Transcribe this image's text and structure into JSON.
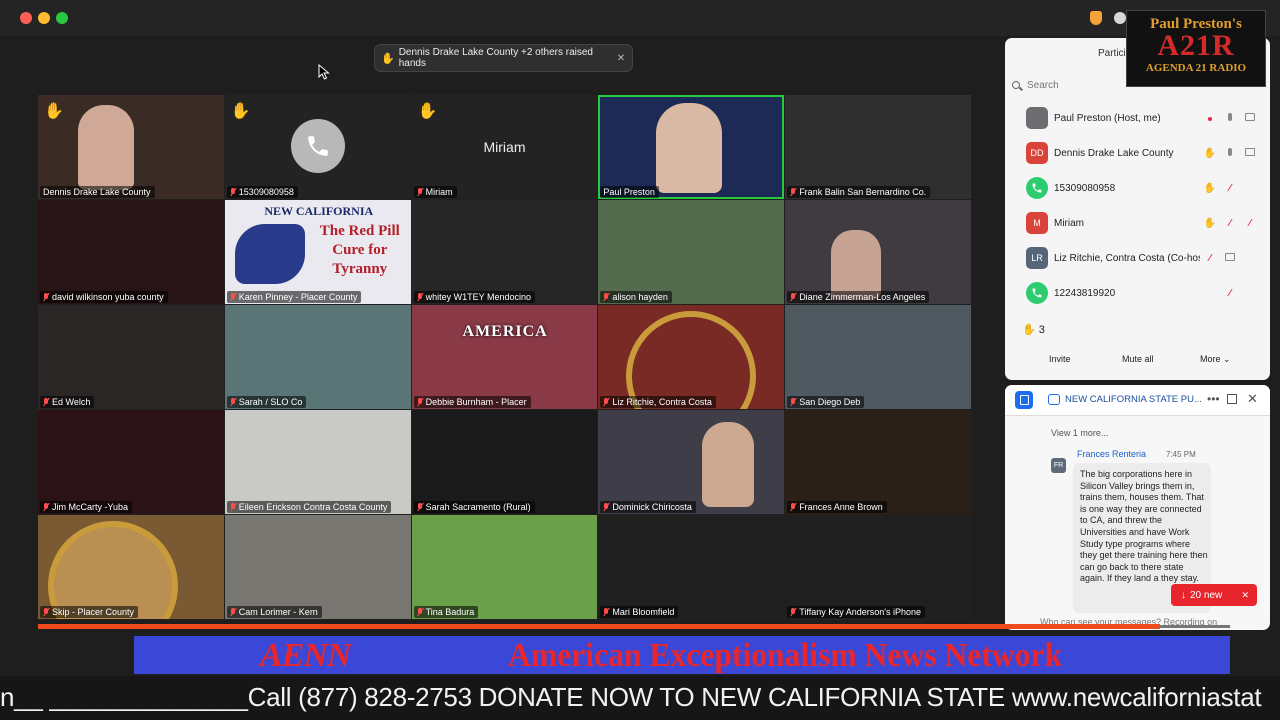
{
  "banner": {
    "text": "Dennis Drake  Lake County +2 others raised hands"
  },
  "hand_icon": "✋",
  "tiles": [
    {
      "name": "Dennis Drake  Lake County",
      "hand": true,
      "bg": "#3a2b24"
    },
    {
      "name": "15309080958",
      "hand": true,
      "phone": true,
      "bg": "#232323"
    },
    {
      "name": "Miriam",
      "hand": true,
      "big": "Miriam",
      "bg": "#232323"
    },
    {
      "name": "Paul Preston",
      "active": true,
      "bg": "#1d2a55"
    },
    {
      "name": "Frank Balin  San Bernardino Co.",
      "bg": "#2f2f2f"
    },
    {
      "name": "david wilkinson yuba county",
      "bg": "#261416"
    },
    {
      "name": "Karen Pinney - Placer County",
      "bg": "#e9e9ef"
    },
    {
      "name": "whitey  W1TEY Mendocino",
      "bg": "#262626"
    },
    {
      "name": "alison hayden",
      "bg": "#556b4e"
    },
    {
      "name": "Diane Zimmerman-Los Angeles",
      "bg": "#3f3b40"
    },
    {
      "name": "Ed Welch",
      "bg": "#2a2626"
    },
    {
      "name": "Sarah / SLO Co",
      "bg": "#5a7575"
    },
    {
      "name": "Debbie Burnham - Placer",
      "bg": "#8a3a46"
    },
    {
      "name": "Liz Ritchie, Contra Costa",
      "bg": "#7a2a25"
    },
    {
      "name": "San Diego Deb",
      "bg": "#4e5a60"
    },
    {
      "name": "Jim McCarty -Yuba",
      "bg": "#2a1217"
    },
    {
      "name": "Eileen Erickson Contra Costa County",
      "bg": "#c9c9c6"
    },
    {
      "name": "Sarah Sacramento (Rural)",
      "bg": "#1a1a1a"
    },
    {
      "name": "Dominick Chiricosta",
      "bg": "#3f3e48"
    },
    {
      "name": "Frances Anne Brown",
      "bg": "#2a2018"
    },
    {
      "name": "Skip - Placer County",
      "bg": "#7a5a32"
    },
    {
      "name": "Cam Lorimer - Kern",
      "bg": "#787670"
    },
    {
      "name": "Tina Badura",
      "bg": "#6aa04a"
    },
    {
      "name": "Mari Bloomfield",
      "bg": "#202020"
    },
    {
      "name": "Tiffany Kay Anderson's iPhone",
      "bg": "#202020"
    }
  ],
  "tile_text": {
    "karen_poster_l1": "NEW CALIFORNIA",
    "karen_poster_l2": "The Red Pill",
    "karen_poster_l3": "Cure for",
    "karen_poster_l4": "Tyranny",
    "debbie_poster": "AMERICA"
  },
  "participants": {
    "title": "Partici",
    "search_placeholder": "Search",
    "rows": [
      {
        "initials": "",
        "name": "Paul Preston (Host, me)",
        "avatar_color": "#6d6d72"
      },
      {
        "initials": "DD",
        "name": "Dennis Drake  Lake County",
        "avatar_color": "#d9443a"
      },
      {
        "initials": "",
        "name": "15309080958",
        "avatar_color": "#2ecc71"
      },
      {
        "initials": "M",
        "name": "Miriam",
        "avatar_color": "#d9443a"
      },
      {
        "initials": "LR",
        "name": "Liz Ritchie, Contra Costa (Co-host)",
        "avatar_color": "#55657a"
      },
      {
        "initials": "",
        "name": "12243819920",
        "avatar_color": "#2ecc71"
      }
    ],
    "hands_count": "3",
    "invite": "Invite",
    "mute_all": "Mute all",
    "more": "More"
  },
  "logo": {
    "line1": "Paul Preston's",
    "line2": "A21R",
    "line3": "AGENDA 21 RADIO"
  },
  "chat": {
    "channel": "NEW CALIFORNIA STATE PU...",
    "view_more": "View 1 more...",
    "sender_initials": "FR",
    "sender": "Frances Renteria",
    "time": "7:45 PM",
    "message": "The big corporations here in Silicon Valley brings them in, trains them, houses them. That is one way they are connected to CA, and threw the Universities and have Work Study type programs where they get there training here then can go back to there state again.  If they land a they stay.",
    "new_badge": "20 new",
    "footer": "Who can see your messages? Recording on"
  },
  "broadcast": {
    "logo": "AENN",
    "title": "American Exceptionalism News Network",
    "ticker": "n__ ______________Call (877) 828-2753 DONATE NOW TO NEW CALIFORNIA STATE www.newcaliforniastat"
  },
  "colors": {
    "accent_green": "#27c93f",
    "accent_red": "#e8242c",
    "ticker_bar": "#3b47d6"
  }
}
